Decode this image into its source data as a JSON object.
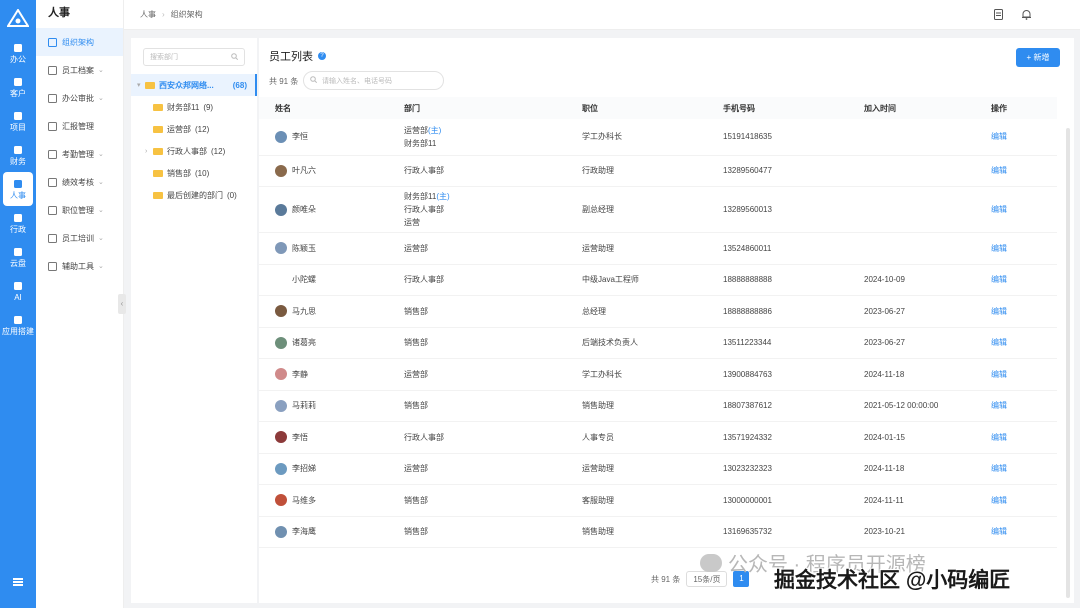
{
  "rail": {
    "items": [
      {
        "label": "办公",
        "icon": "office-icon"
      },
      {
        "label": "客户",
        "icon": "customer-icon"
      },
      {
        "label": "项目",
        "icon": "project-icon"
      },
      {
        "label": "财务",
        "icon": "finance-icon"
      },
      {
        "label": "人事",
        "icon": "hr-icon"
      },
      {
        "label": "行政",
        "icon": "admin-icon"
      },
      {
        "label": "云盘",
        "icon": "cloud-disk-icon"
      },
      {
        "label": "AI",
        "icon": "ai-icon"
      },
      {
        "label": "应用搭建",
        "icon": "app-builder-icon"
      }
    ],
    "bottom_icon": "menu-icon"
  },
  "sidebar": {
    "title": "人事",
    "items": [
      {
        "label": "组织架构",
        "icon": "org-chart-icon",
        "chevron": false,
        "active": true
      },
      {
        "label": "员工档案",
        "icon": "file-icon",
        "chevron": true
      },
      {
        "label": "办公审批",
        "icon": "approval-icon",
        "chevron": true
      },
      {
        "label": "汇报管理",
        "icon": "report-icon",
        "chevron": false
      },
      {
        "label": "考勤管理",
        "icon": "attendance-icon",
        "chevron": true
      },
      {
        "label": "绩效考核",
        "icon": "performance-icon",
        "chevron": true
      },
      {
        "label": "职位管理",
        "icon": "position-icon",
        "chevron": true
      },
      {
        "label": "员工培训",
        "icon": "training-icon",
        "chevron": true
      },
      {
        "label": "辅助工具",
        "icon": "tools-icon",
        "chevron": true
      }
    ]
  },
  "breadcrumb": [
    "人事",
    "组织架构"
  ],
  "tree": {
    "search_placeholder": "搜索部门",
    "root": {
      "label": "西安众邦网络...",
      "count": "(68)"
    },
    "children": [
      {
        "label": "财务部11",
        "count": "(9)",
        "expandable": false
      },
      {
        "label": "运营部",
        "count": "(12)",
        "expandable": false
      },
      {
        "label": "行政人事部",
        "count": "(12)",
        "expandable": true
      },
      {
        "label": "销售部",
        "count": "(10)",
        "expandable": false
      },
      {
        "label": "最后创建的部门",
        "count": "(0)",
        "expandable": false
      }
    ]
  },
  "main": {
    "title": "员工列表",
    "add_label": "+ 新增",
    "total": "共 91 条",
    "search_placeholder": "请输入姓名、电话号码",
    "columns": [
      "姓名",
      "部门",
      "职位",
      "手机号码",
      "加入时间",
      "操作"
    ],
    "rows": [
      {
        "name": "李恒",
        "dept": [
          {
            "text": "运营部",
            "tag": "(主)"
          },
          {
            "text": "财务部11",
            "tag": ""
          }
        ],
        "position": "学工办科长",
        "phone": "15191418635",
        "joined": "",
        "action": "编辑",
        "avatar": "#6b8fb5"
      },
      {
        "name": "叶凡六",
        "dept": [
          {
            "text": "行政人事部",
            "tag": ""
          }
        ],
        "position": "行政助理",
        "phone": "13289560477",
        "joined": "",
        "action": "编辑",
        "avatar": "#8a6a4c"
      },
      {
        "name": "颜唯朵",
        "dept": [
          {
            "text": "财务部11",
            "tag": "(主)"
          },
          {
            "text": "行政人事部",
            "tag": ""
          },
          {
            "text": "运营",
            "tag": ""
          }
        ],
        "position": "副总经理",
        "phone": "13289560013",
        "joined": "",
        "action": "编辑",
        "avatar": "#5a7a9a"
      },
      {
        "name": "陈颖玉",
        "dept": [
          {
            "text": "运营部",
            "tag": ""
          }
        ],
        "position": "运营助理",
        "phone": "13524860011",
        "joined": "",
        "action": "编辑",
        "avatar": "#7f98b8"
      },
      {
        "name": "小陀螺",
        "dept": [
          {
            "text": "行政人事部",
            "tag": ""
          }
        ],
        "position": "中级Java工程师",
        "phone": "18888888888",
        "joined": "2024-10-09",
        "action": "编辑",
        "avatar": ""
      },
      {
        "name": "马九思",
        "dept": [
          {
            "text": "销售部",
            "tag": ""
          }
        ],
        "position": "总经理",
        "phone": "18888888886",
        "joined": "2023-06-27",
        "action": "编辑",
        "avatar": "#7a5a40"
      },
      {
        "name": "诸葛亮",
        "dept": [
          {
            "text": "销售部",
            "tag": ""
          }
        ],
        "position": "后端技术负责人",
        "phone": "13511223344",
        "joined": "2023-06-27",
        "action": "编辑",
        "avatar": "#6d8f7a"
      },
      {
        "name": "李静",
        "dept": [
          {
            "text": "运营部",
            "tag": ""
          }
        ],
        "position": "学工办科长",
        "phone": "13900884763",
        "joined": "2024-11-18",
        "action": "编辑",
        "avatar": "#d08a8a"
      },
      {
        "name": "马莉莉",
        "dept": [
          {
            "text": "销售部",
            "tag": ""
          }
        ],
        "position": "销售助理",
        "phone": "18807387612",
        "joined": "2021-05-12 00:00:00",
        "action": "编辑",
        "avatar": "#8aa0c0"
      },
      {
        "name": "李悟",
        "dept": [
          {
            "text": "行政人事部",
            "tag": ""
          }
        ],
        "position": "人事专员",
        "phone": "13571924332",
        "joined": "2024-01-15",
        "action": "编辑",
        "avatar": "#8c3a3a"
      },
      {
        "name": "李招娣",
        "dept": [
          {
            "text": "运营部",
            "tag": ""
          }
        ],
        "position": "运营助理",
        "phone": "13023232323",
        "joined": "2024-11-18",
        "action": "编辑",
        "avatar": "#6c9ac0"
      },
      {
        "name": "马维多",
        "dept": [
          {
            "text": "销售部",
            "tag": ""
          }
        ],
        "position": "客服助理",
        "phone": "13000000001",
        "joined": "2024-11-11",
        "action": "编辑",
        "avatar": "#c0503a"
      },
      {
        "name": "李海鹰",
        "dept": [
          {
            "text": "销售部",
            "tag": ""
          }
        ],
        "position": "销售助理",
        "phone": "13169635732",
        "joined": "2023-10-21",
        "action": "编辑",
        "avatar": "#7090b0"
      }
    ],
    "pager": {
      "total": "共 91 条",
      "page_size": "15条/页",
      "page": "1"
    }
  },
  "watermark": {
    "line1": "公众号 · 程序员开源榜",
    "line2": "掘金技术社区 @小码编匠"
  },
  "colors": {
    "primary": "#2f8cf0",
    "folder": "#f7c242"
  }
}
